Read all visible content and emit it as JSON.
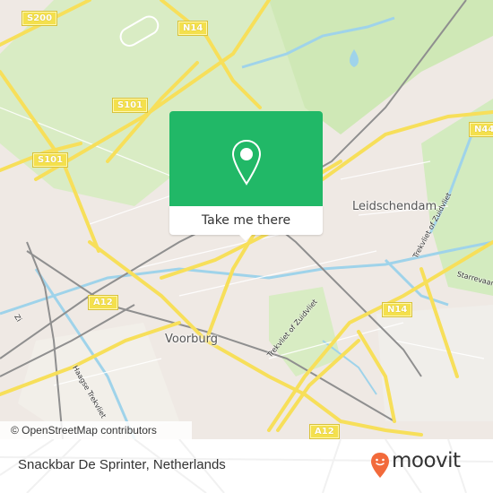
{
  "map": {
    "road_labels": [
      {
        "id": "s200",
        "text": "S200"
      },
      {
        "id": "n14-top",
        "text": "N14"
      },
      {
        "id": "s101-mid",
        "text": "S101"
      },
      {
        "id": "s101-left",
        "text": "S101"
      },
      {
        "id": "n44x",
        "text": "N44"
      },
      {
        "id": "a12-left",
        "text": "A12"
      },
      {
        "id": "n14-right",
        "text": "N14"
      },
      {
        "id": "a12-bottom",
        "text": "A12"
      }
    ],
    "place_labels": [
      {
        "id": "leidschendam",
        "text": "Leidschendam"
      },
      {
        "id": "voorburg",
        "text": "Voorburg"
      }
    ],
    "water_labels": [
      {
        "id": "trekvliet-zuidvliet-upper",
        "text": "Trekvliet of Zuidvliet"
      },
      {
        "id": "trekvliet-zuidvliet-lower",
        "text": "Trekvliet of Zuidvliet"
      },
      {
        "id": "haagse-trekvliet",
        "text": "Haagse Trekvliet"
      },
      {
        "id": "starrevaart",
        "text": "Starrevaart"
      },
      {
        "id": "zi",
        "text": "Zi"
      }
    ],
    "attribution": "© OpenStreetMap contributors"
  },
  "popup": {
    "icon": "location-pin-icon",
    "button_label": "Take me there",
    "accent_color": "#21b867"
  },
  "footer": {
    "place_name": "Snackbar De Sprinter, Netherlands",
    "logo_text": "moovit",
    "logo_color": "#f26a3b"
  }
}
